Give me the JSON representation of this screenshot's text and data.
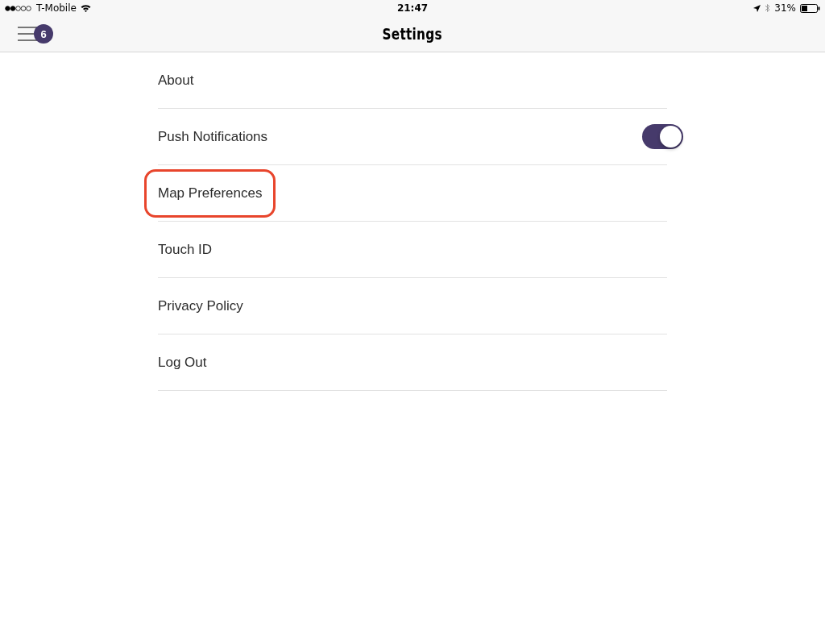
{
  "status_bar": {
    "carrier": "T-Mobile",
    "time": "21:47",
    "battery": "31%"
  },
  "nav": {
    "title": "Settings",
    "badge": "6"
  },
  "items": [
    {
      "label": "About",
      "kind": "link",
      "highlighted": false
    },
    {
      "label": "Push Notifications",
      "kind": "toggle",
      "on": true,
      "highlighted": false
    },
    {
      "label": "Map Preferences",
      "kind": "link",
      "highlighted": true
    },
    {
      "label": "Touch ID",
      "kind": "link",
      "highlighted": false
    },
    {
      "label": "Privacy Policy",
      "kind": "link",
      "highlighted": false
    },
    {
      "label": "Log Out",
      "kind": "link",
      "highlighted": false
    }
  ]
}
